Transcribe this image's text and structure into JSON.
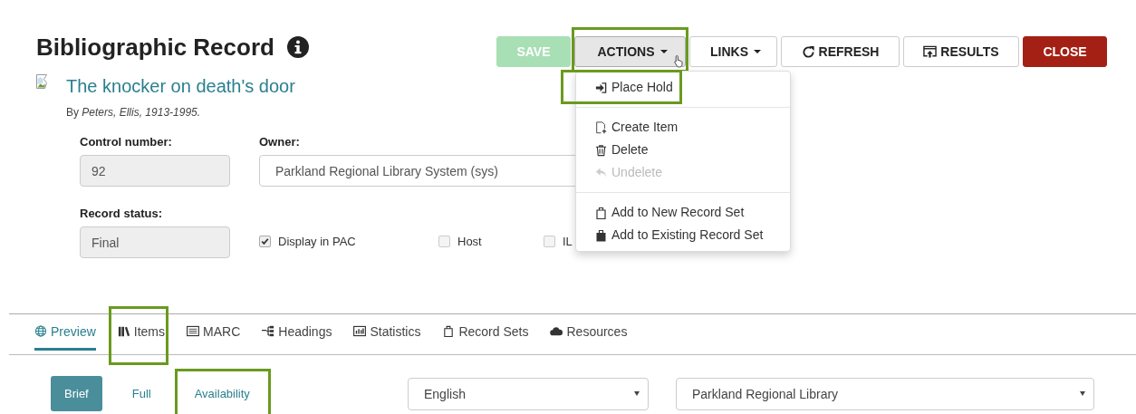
{
  "header": {
    "title": "Bibliographic Record"
  },
  "buttons": [
    {
      "label": "SAVE",
      "kind": "save",
      "disabled": true,
      "highlighted": false,
      "open": false
    },
    {
      "label": "ACTIONS",
      "kind": "dropdown",
      "disabled": false,
      "highlighted": true,
      "open": true
    },
    {
      "label": "LINKS",
      "kind": "dropdown",
      "disabled": false,
      "highlighted": false,
      "open": false
    },
    {
      "label": "REFRESH",
      "kind": "refresh",
      "disabled": false,
      "highlighted": false,
      "open": false
    },
    {
      "label": "RESULTS",
      "kind": "results",
      "disabled": false,
      "highlighted": false,
      "open": false
    },
    {
      "label": "CLOSE",
      "kind": "close",
      "disabled": false,
      "highlighted": false,
      "open": false
    }
  ],
  "actions_menu": {
    "groups": [
      [
        {
          "label": "Place Hold",
          "kind": "hold",
          "disabled": false,
          "highlighted": true
        }
      ],
      [
        {
          "label": "Create Item",
          "kind": "create",
          "disabled": false,
          "highlighted": false
        },
        {
          "label": "Delete",
          "kind": "delete",
          "disabled": false,
          "highlighted": false
        },
        {
          "label": "Undelete",
          "kind": "undelete",
          "disabled": true,
          "highlighted": false
        }
      ],
      [
        {
          "label": "Add to New Record Set",
          "kind": "newset",
          "disabled": false,
          "highlighted": false
        },
        {
          "label": "Add to Existing Record Set",
          "kind": "existingset",
          "disabled": false,
          "highlighted": false
        }
      ]
    ]
  },
  "record": {
    "title": "The knocker on death's door",
    "byline": "By *Peters, Ellis, 1913-1995.*"
  },
  "fields": {
    "control_number": {
      "label": "Control number:",
      "value": "92"
    },
    "owner": {
      "label": "Owner:",
      "value": "Parkland Regional Library System (sys)"
    },
    "record_status": {
      "label": "Record status:",
      "value": "Final"
    }
  },
  "checkboxes": [
    {
      "label": "Display in PAC",
      "checked": true
    },
    {
      "label": "Host",
      "checked": false
    },
    {
      "label": "IL",
      "checked": false
    }
  ],
  "tabs": [
    {
      "label": "Preview",
      "kind": "globe",
      "selected": true,
      "highlighted": false
    },
    {
      "label": "Items",
      "kind": "books",
      "selected": false,
      "highlighted": true
    },
    {
      "label": "MARC",
      "kind": "list",
      "selected": false,
      "highlighted": false
    },
    {
      "label": "Headings",
      "kind": "tree",
      "selected": false,
      "highlighted": false
    },
    {
      "label": "Statistics",
      "kind": "chart",
      "selected": false,
      "highlighted": false
    },
    {
      "label": "Record Sets",
      "kind": "bag",
      "selected": false,
      "highlighted": false
    },
    {
      "label": "Resources",
      "kind": "cloud",
      "selected": false,
      "highlighted": false
    }
  ],
  "views": [
    {
      "label": "Brief",
      "selected": true,
      "highlighted": false
    },
    {
      "label": "Full",
      "selected": false,
      "highlighted": false
    },
    {
      "label": "Availability",
      "selected": false,
      "highlighted": true
    }
  ],
  "language_select": {
    "value": "English"
  },
  "library_select": {
    "value": "Parkland Regional Library"
  }
}
